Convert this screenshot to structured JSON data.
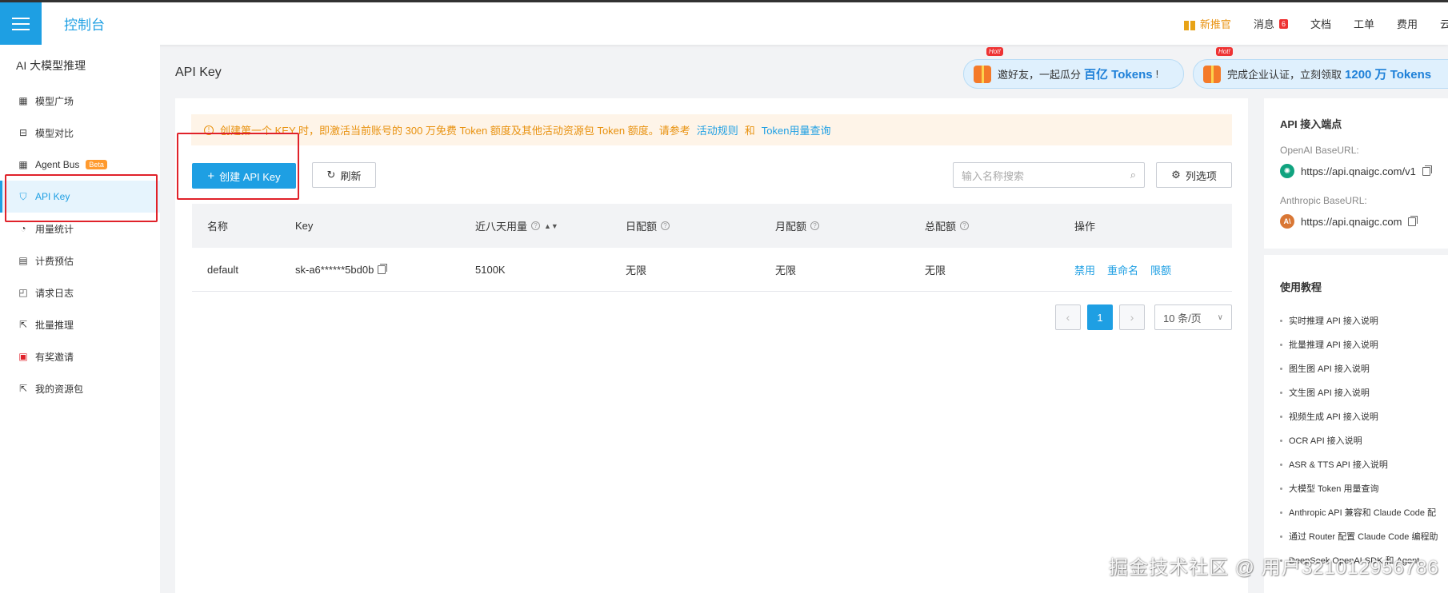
{
  "header": {
    "console_title": "控制台",
    "items": [
      {
        "label": "新推官",
        "icon": "gift-icon"
      },
      {
        "label": "消息",
        "badge": "6"
      },
      {
        "label": "文档"
      },
      {
        "label": "工单"
      },
      {
        "label": "费用"
      },
      {
        "label": "云"
      }
    ]
  },
  "sidebar": {
    "title": "AI 大模型推理",
    "items": [
      {
        "label": "模型广场",
        "icon": "grid-icon"
      },
      {
        "label": "模型对比",
        "icon": "compare-icon"
      },
      {
        "label": "Agent Bus",
        "icon": "grid-icon",
        "badge": "Beta"
      },
      {
        "label": "API Key",
        "icon": "key-icon",
        "active": true
      },
      {
        "label": "用量统计",
        "icon": "chart-icon"
      },
      {
        "label": "计费预估",
        "icon": "calculator-icon"
      },
      {
        "label": "请求日志",
        "icon": "log-icon"
      },
      {
        "label": "批量推理",
        "icon": "batch-icon"
      },
      {
        "label": "有奖邀请",
        "icon": "gift-icon"
      },
      {
        "label": "我的资源包",
        "icon": "package-icon"
      }
    ]
  },
  "page": {
    "title": "API Key",
    "banners": [
      {
        "text": "邀好友，一起瓜分",
        "highlight": "百亿 Tokens",
        "suffix": "!",
        "hot": "Hot!"
      },
      {
        "text": "完成企业认证，立刻领取",
        "highlight": "1200 万 Tokens",
        "suffix": "",
        "hot": "Hot!"
      }
    ]
  },
  "notice": {
    "text": "创建第一个 KEY 时，即激活当前账号的 300 万免费 Token 额度及其他活动资源包 Token 额度。请参考",
    "link1": "活动规则",
    "conj": "和",
    "link2": "Token用量查询"
  },
  "toolbar": {
    "create_label": "创建 API Key",
    "refresh_label": "刷新",
    "search_placeholder": "输入名称搜索",
    "columns_label": "列选项"
  },
  "table": {
    "columns": [
      "名称",
      "Key",
      "近八天用量",
      "日配额",
      "月配额",
      "总配额",
      "操作"
    ],
    "rows": [
      {
        "name": "default",
        "key": "sk-a6******5bd0b",
        "usage": "5100K",
        "daily": "无限",
        "monthly": "无限",
        "total": "无限",
        "ops": [
          "禁用",
          "重命名",
          "限额"
        ]
      }
    ]
  },
  "pagination": {
    "current": "1",
    "page_size": "10 条/页"
  },
  "endpoints": {
    "title": "API 接入端点",
    "openai_label": "OpenAI BaseURL:",
    "openai_url": "https://api.qnaigc.com/v1",
    "anthropic_label": "Anthropic BaseURL:",
    "anthropic_url": "https://api.qnaigc.com"
  },
  "tutorials": {
    "title": "使用教程",
    "items": [
      "实时推理 API 接入说明",
      "批量推理 API 接入说明",
      "图生图 API 接入说明",
      "文生图 API 接入说明",
      "视频生成 API 接入说明",
      "OCR API 接入说明",
      "ASR & TTS API 接入说明",
      "大模型 Token 用量查询",
      "Anthropic API 兼容和 Claude Code 配",
      "通过 Router 配置 Claude Code 编程助",
      "DeepSeek OpenAI SDK 和 Agent"
    ]
  },
  "watermark": "掘金技术社区 @ 用户3210129567​86"
}
